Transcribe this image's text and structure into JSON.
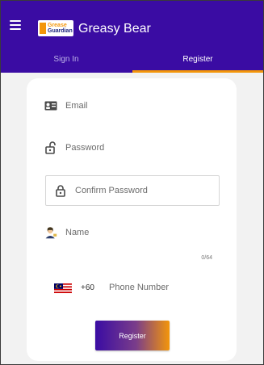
{
  "appbar": {
    "logo_line1": "Grease",
    "logo_line2": "Guardian",
    "title": "Greasy Bear"
  },
  "tabs": [
    {
      "label": "Sign In",
      "active": false
    },
    {
      "label": "Register",
      "active": true
    }
  ],
  "form": {
    "email_placeholder": "Email",
    "password_placeholder": "Password",
    "confirm_password_placeholder": "Confirm Password",
    "name_placeholder": "Name",
    "name_counter": "0/64",
    "country_code": "+60",
    "phone_placeholder": "Phone Number",
    "register_label": "Register"
  },
  "icons": {
    "menu": "hamburger-icon",
    "email": "id-card-icon",
    "password": "unlocked-padlock-icon",
    "confirm_password": "padlock-icon",
    "name": "avatar-icon",
    "country": "malaysia-flag-icon"
  },
  "colors": {
    "brand": "#3a0ca3",
    "accent": "#f3960a"
  }
}
